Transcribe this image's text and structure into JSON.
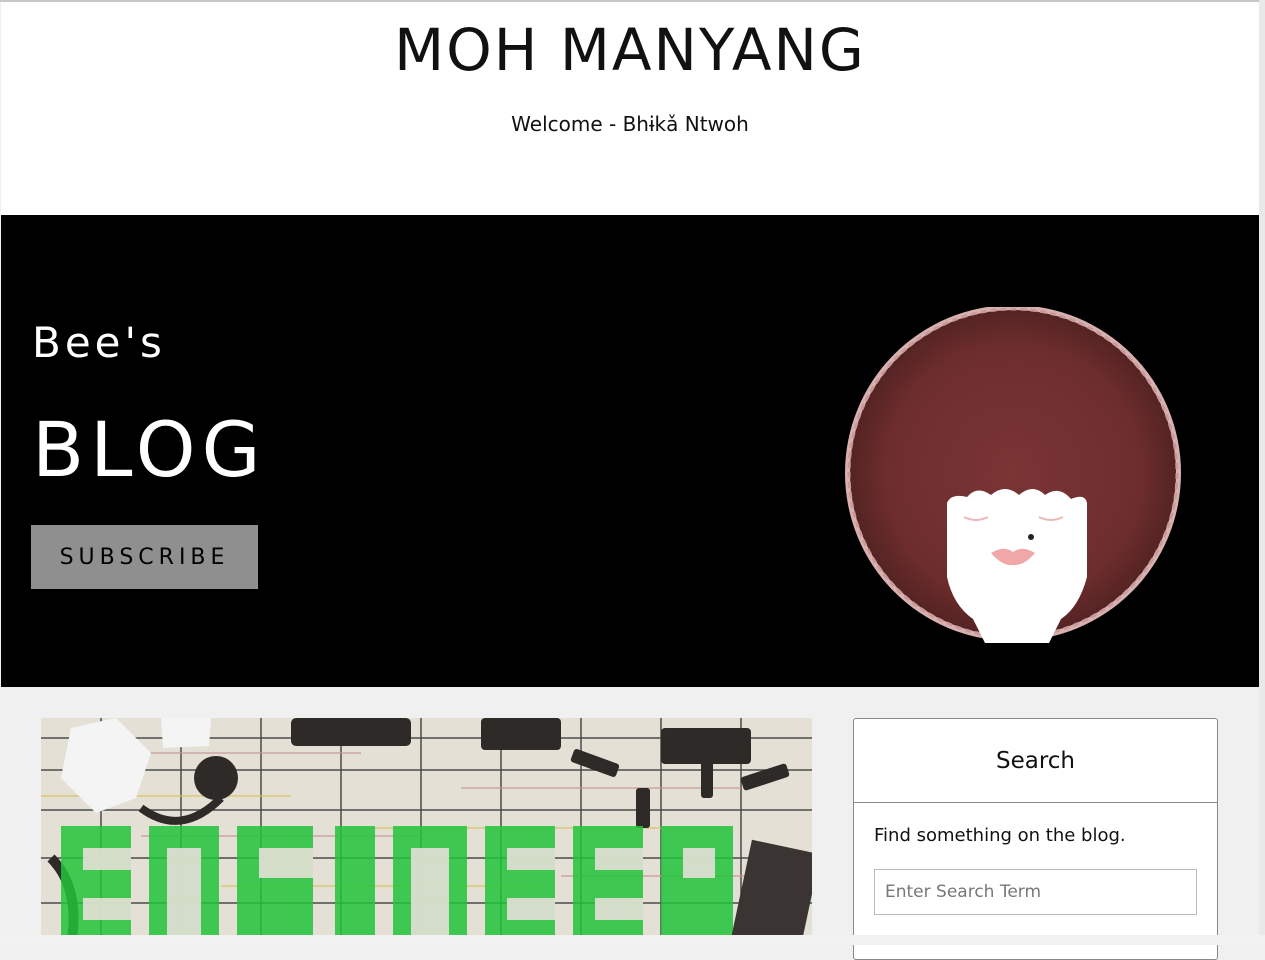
{
  "header": {
    "site_title": "MOH MANYANG",
    "tagline": "Welcome - Bhɨkǎ Ntwoh"
  },
  "hero": {
    "subtitle": "Bee's",
    "title": "BLOG",
    "subscribe_label": "SUBSCRIBE",
    "background_color": "#000000",
    "button_color": "#8f8f8f",
    "avatar_icon": "afro-woman-avatar-icon"
  },
  "post": {
    "image_text": "ENGINEER",
    "image_icon": "engineer-collage-image"
  },
  "sidebar": {
    "search_widget": {
      "heading": "Search",
      "description": "Find something on the blog.",
      "placeholder": "Enter Search Term"
    }
  }
}
